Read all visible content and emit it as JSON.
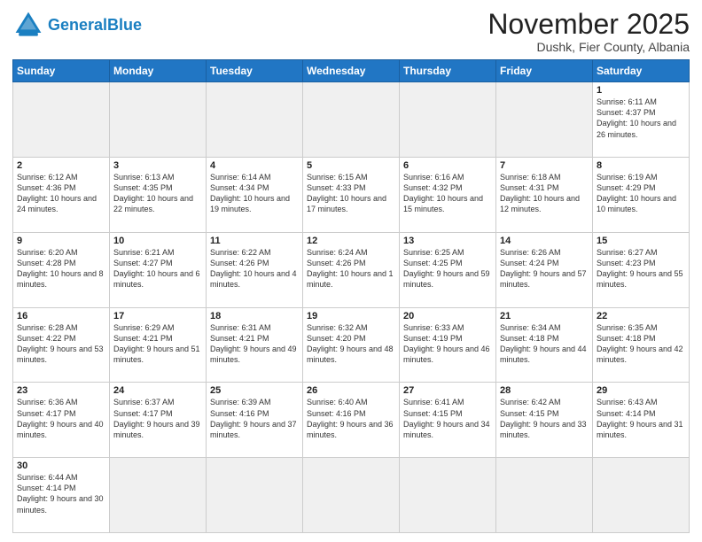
{
  "header": {
    "logo_general": "General",
    "logo_blue": "Blue",
    "month_title": "November 2025",
    "location": "Dushk, Fier County, Albania"
  },
  "days_of_week": [
    "Sunday",
    "Monday",
    "Tuesday",
    "Wednesday",
    "Thursday",
    "Friday",
    "Saturday"
  ],
  "weeks": [
    [
      {
        "day": "",
        "empty": true
      },
      {
        "day": "",
        "empty": true
      },
      {
        "day": "",
        "empty": true
      },
      {
        "day": "",
        "empty": true
      },
      {
        "day": "",
        "empty": true
      },
      {
        "day": "",
        "empty": true
      },
      {
        "day": "1",
        "sunrise": "6:11 AM",
        "sunset": "4:37 PM",
        "daylight": "10 hours and 26 minutes."
      }
    ],
    [
      {
        "day": "2",
        "sunrise": "6:12 AM",
        "sunset": "4:36 PM",
        "daylight": "10 hours and 24 minutes."
      },
      {
        "day": "3",
        "sunrise": "6:13 AM",
        "sunset": "4:35 PM",
        "daylight": "10 hours and 22 minutes."
      },
      {
        "day": "4",
        "sunrise": "6:14 AM",
        "sunset": "4:34 PM",
        "daylight": "10 hours and 19 minutes."
      },
      {
        "day": "5",
        "sunrise": "6:15 AM",
        "sunset": "4:33 PM",
        "daylight": "10 hours and 17 minutes."
      },
      {
        "day": "6",
        "sunrise": "6:16 AM",
        "sunset": "4:32 PM",
        "daylight": "10 hours and 15 minutes."
      },
      {
        "day": "7",
        "sunrise": "6:18 AM",
        "sunset": "4:31 PM",
        "daylight": "10 hours and 12 minutes."
      },
      {
        "day": "8",
        "sunrise": "6:19 AM",
        "sunset": "4:29 PM",
        "daylight": "10 hours and 10 minutes."
      }
    ],
    [
      {
        "day": "9",
        "sunrise": "6:20 AM",
        "sunset": "4:28 PM",
        "daylight": "10 hours and 8 minutes."
      },
      {
        "day": "10",
        "sunrise": "6:21 AM",
        "sunset": "4:27 PM",
        "daylight": "10 hours and 6 minutes."
      },
      {
        "day": "11",
        "sunrise": "6:22 AM",
        "sunset": "4:26 PM",
        "daylight": "10 hours and 4 minutes."
      },
      {
        "day": "12",
        "sunrise": "6:24 AM",
        "sunset": "4:26 PM",
        "daylight": "10 hours and 1 minute."
      },
      {
        "day": "13",
        "sunrise": "6:25 AM",
        "sunset": "4:25 PM",
        "daylight": "9 hours and 59 minutes."
      },
      {
        "day": "14",
        "sunrise": "6:26 AM",
        "sunset": "4:24 PM",
        "daylight": "9 hours and 57 minutes."
      },
      {
        "day": "15",
        "sunrise": "6:27 AM",
        "sunset": "4:23 PM",
        "daylight": "9 hours and 55 minutes."
      }
    ],
    [
      {
        "day": "16",
        "sunrise": "6:28 AM",
        "sunset": "4:22 PM",
        "daylight": "9 hours and 53 minutes."
      },
      {
        "day": "17",
        "sunrise": "6:29 AM",
        "sunset": "4:21 PM",
        "daylight": "9 hours and 51 minutes."
      },
      {
        "day": "18",
        "sunrise": "6:31 AM",
        "sunset": "4:21 PM",
        "daylight": "9 hours and 49 minutes."
      },
      {
        "day": "19",
        "sunrise": "6:32 AM",
        "sunset": "4:20 PM",
        "daylight": "9 hours and 48 minutes."
      },
      {
        "day": "20",
        "sunrise": "6:33 AM",
        "sunset": "4:19 PM",
        "daylight": "9 hours and 46 minutes."
      },
      {
        "day": "21",
        "sunrise": "6:34 AM",
        "sunset": "4:18 PM",
        "daylight": "9 hours and 44 minutes."
      },
      {
        "day": "22",
        "sunrise": "6:35 AM",
        "sunset": "4:18 PM",
        "daylight": "9 hours and 42 minutes."
      }
    ],
    [
      {
        "day": "23",
        "sunrise": "6:36 AM",
        "sunset": "4:17 PM",
        "daylight": "9 hours and 40 minutes."
      },
      {
        "day": "24",
        "sunrise": "6:37 AM",
        "sunset": "4:17 PM",
        "daylight": "9 hours and 39 minutes."
      },
      {
        "day": "25",
        "sunrise": "6:39 AM",
        "sunset": "4:16 PM",
        "daylight": "9 hours and 37 minutes."
      },
      {
        "day": "26",
        "sunrise": "6:40 AM",
        "sunset": "4:16 PM",
        "daylight": "9 hours and 36 minutes."
      },
      {
        "day": "27",
        "sunrise": "6:41 AM",
        "sunset": "4:15 PM",
        "daylight": "9 hours and 34 minutes."
      },
      {
        "day": "28",
        "sunrise": "6:42 AM",
        "sunset": "4:15 PM",
        "daylight": "9 hours and 33 minutes."
      },
      {
        "day": "29",
        "sunrise": "6:43 AM",
        "sunset": "4:14 PM",
        "daylight": "9 hours and 31 minutes."
      }
    ],
    [
      {
        "day": "30",
        "sunrise": "6:44 AM",
        "sunset": "4:14 PM",
        "daylight": "9 hours and 30 minutes."
      },
      {
        "day": "",
        "empty": true
      },
      {
        "day": "",
        "empty": true
      },
      {
        "day": "",
        "empty": true
      },
      {
        "day": "",
        "empty": true
      },
      {
        "day": "",
        "empty": true
      },
      {
        "day": "",
        "empty": true
      }
    ]
  ]
}
